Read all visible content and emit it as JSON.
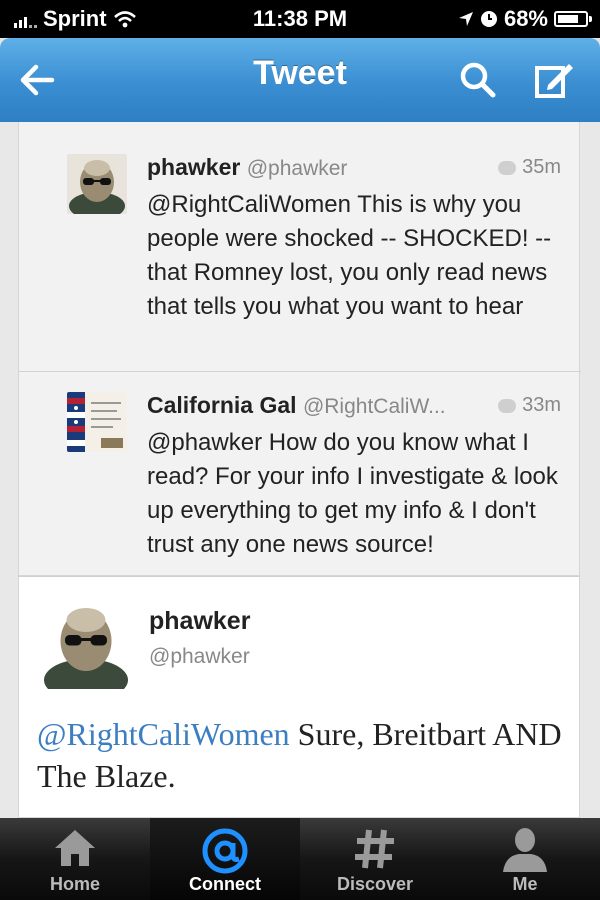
{
  "status_bar": {
    "carrier": "Sprint",
    "time": "11:38 PM",
    "battery": "68%",
    "battery_level": 0.68,
    "icons": [
      "signal-icon",
      "wifi-icon",
      "location-icon",
      "clock-icon",
      "battery-icon"
    ]
  },
  "nav": {
    "title": "Tweet",
    "back_icon": "back-arrow-icon",
    "search_icon": "search-icon",
    "compose_icon": "compose-icon"
  },
  "replies": [
    {
      "name": "phawker",
      "handle": "@phawker",
      "time": "35m",
      "text": "@RightCaliWomen This is why you people were shocked -- SHOCKED! -- that Romney lost, you only read news that tells you what you want to hear"
    },
    {
      "name": "California Gal",
      "handle": "@RightCaliW...",
      "time": "33m",
      "text": "@phawker How do you know what I read? For your info I investigate & look up everything to get my info & I don't trust any one news source!"
    }
  ],
  "main_tweet": {
    "name": "phawker",
    "handle": "@phawker",
    "mention": "@RightCaliWomen",
    "text": " Sure, Breitbart AND The Blaze."
  },
  "tabs": [
    {
      "label": "Home",
      "icon": "home-icon"
    },
    {
      "label": "Connect",
      "icon": "at-icon"
    },
    {
      "label": "Discover",
      "icon": "hashtag-icon"
    },
    {
      "label": "Me",
      "icon": "person-icon"
    }
  ],
  "colors": {
    "nav_blue": "#3a8ed1",
    "mention_blue": "#3b7ec2",
    "tab_active_icon": "#1e90ff"
  }
}
